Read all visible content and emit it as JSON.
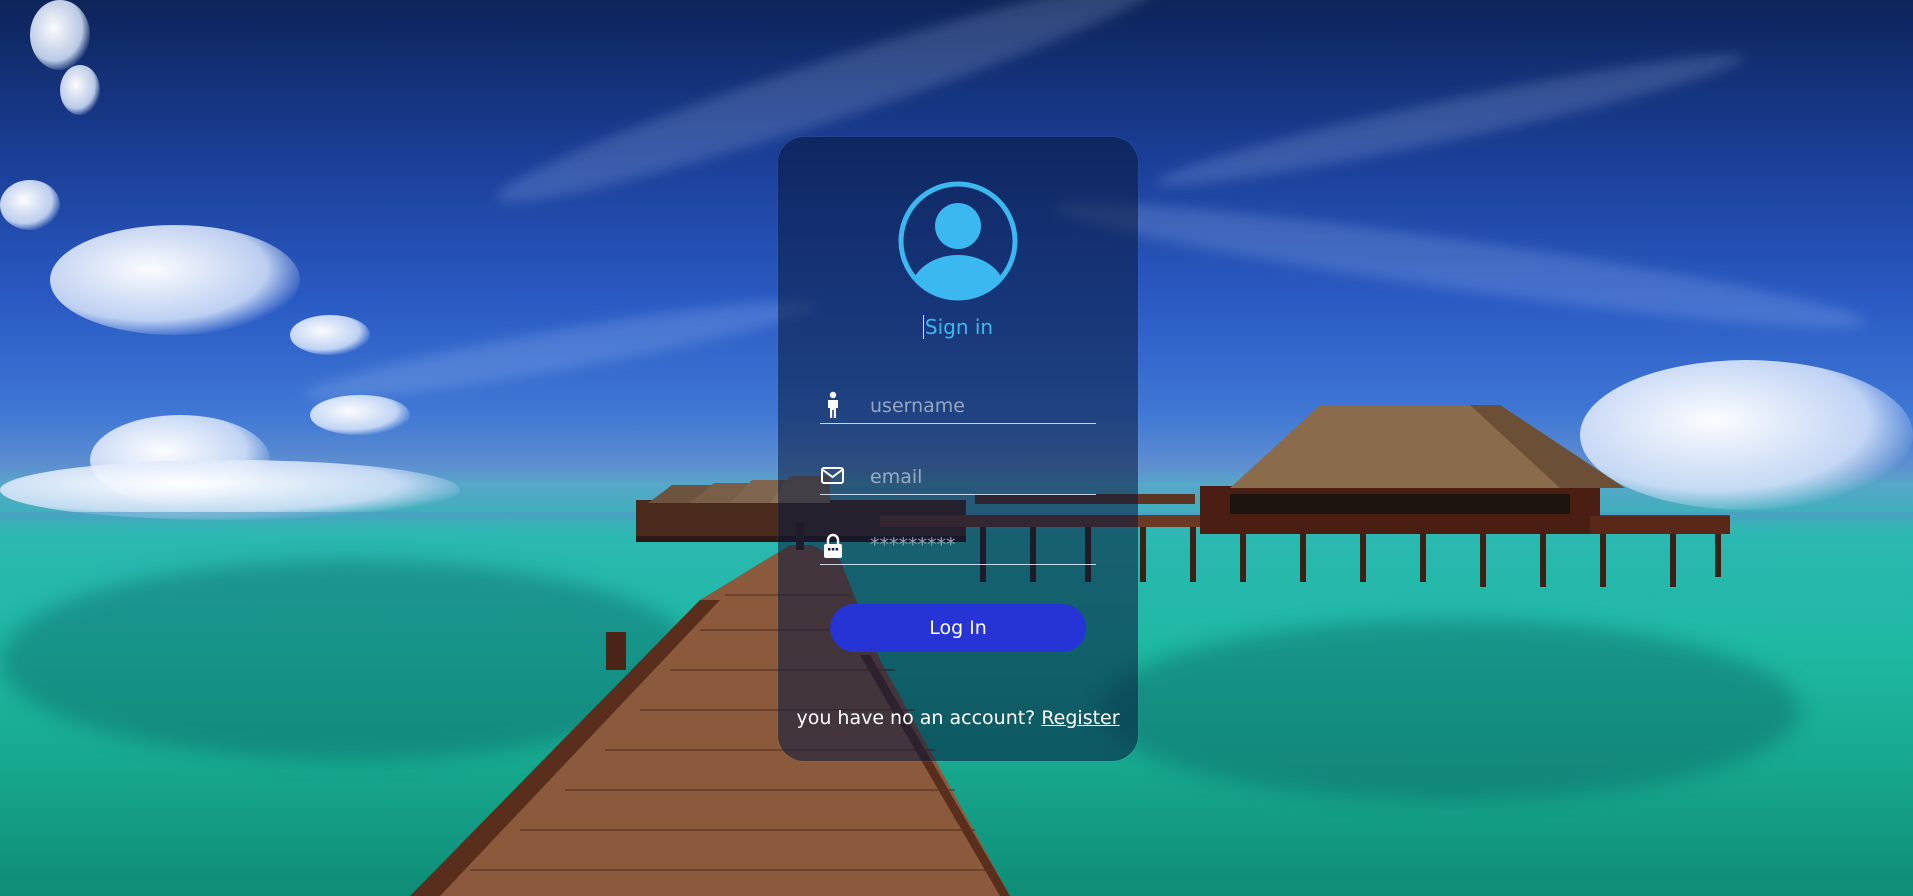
{
  "login": {
    "title": "Sign in",
    "username": {
      "placeholder": "username",
      "value": "",
      "icon": "person-icon"
    },
    "email": {
      "placeholder": "email",
      "value": "",
      "icon": "envelope-icon"
    },
    "password": {
      "placeholder": "*********",
      "value": "",
      "icon": "lock-icon"
    },
    "submit_label": "Log In",
    "footer": {
      "prompt": "you have no an account? ",
      "link_label": "Register"
    }
  },
  "colors": {
    "accent": "#3bb8f0",
    "button": "#2634d6",
    "card": "rgba(8,24,60,0.55)"
  }
}
